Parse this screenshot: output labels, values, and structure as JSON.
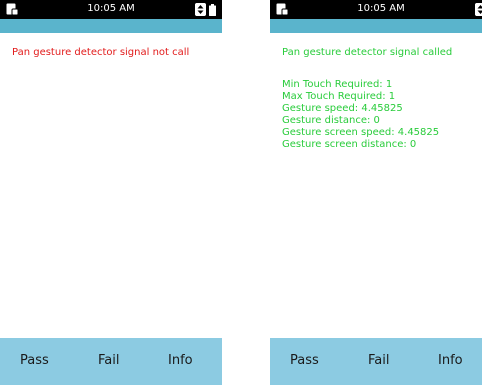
{
  "status_bar": {
    "time": "10:05 AM",
    "icons": {
      "left": "device-icon",
      "data_transfer": "updown-arrows-icon",
      "battery": "battery-icon"
    }
  },
  "colors": {
    "status_bar": "#000000",
    "title_bar": "#5ab4cc",
    "button_bar": "#8ccbe2",
    "error_text": "#e21b1b",
    "success_text": "#29cc3b"
  },
  "screens": [
    {
      "message": "Pan gesture detector signal not call",
      "details": []
    },
    {
      "message": "Pan gesture detector signal called",
      "details": [
        "Min Touch Required: 1",
        "Max Touch Required: 1",
        "Gesture speed: 4.45825",
        "Gesture distance: 0",
        "Gesture screen speed: 4.45825",
        "Gesture screen distance: 0"
      ]
    }
  ],
  "buttons": {
    "pass": "Pass",
    "fail": "Fail",
    "info": "Info"
  }
}
